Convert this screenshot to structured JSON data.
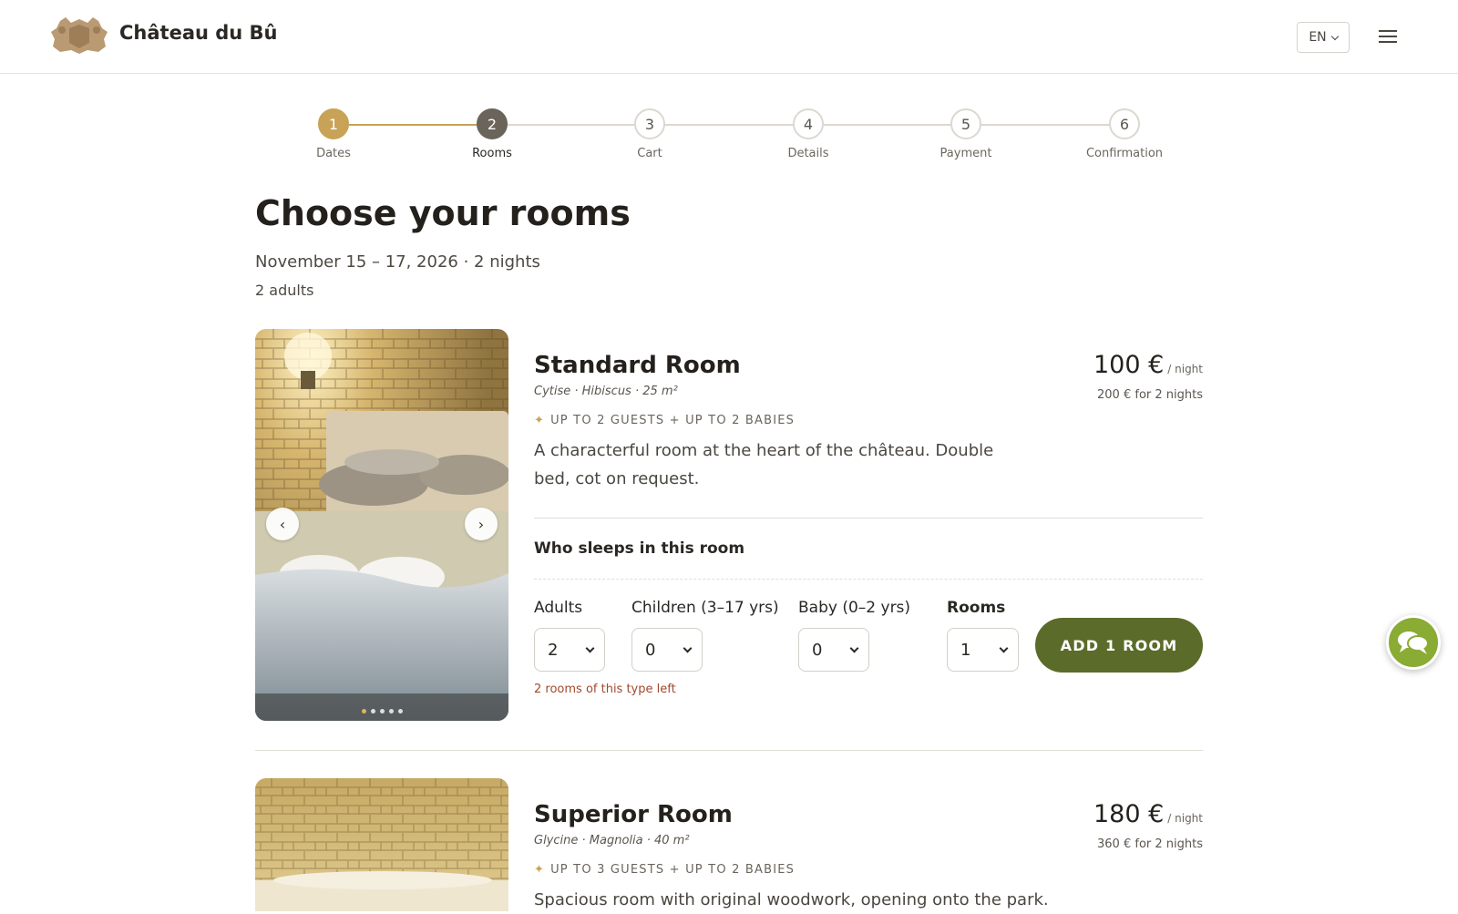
{
  "header": {
    "brand": "Château du Bû",
    "language": "EN"
  },
  "stepper": {
    "steps": [
      {
        "number": "1",
        "label": "Dates",
        "state": "done"
      },
      {
        "number": "2",
        "label": "Rooms",
        "state": "active"
      },
      {
        "number": "3",
        "label": "Cart",
        "state": "todo"
      },
      {
        "number": "4",
        "label": "Details",
        "state": "todo"
      },
      {
        "number": "5",
        "label": "Payment",
        "state": "todo"
      },
      {
        "number": "6",
        "label": "Confirmation",
        "state": "todo"
      }
    ]
  },
  "page": {
    "title": "Choose your rooms",
    "dates": "November 15 – 17, 2026 · 2 nights",
    "guests": "2 adults"
  },
  "rooms": [
    {
      "name": "Standard Room",
      "subtitle": "Cytise · Hibiscus · 25 m²",
      "capacity": "UP TO 2 GUESTS + UP TO 2 BABIES",
      "description": "A characterful room at the heart of the château. Double bed, cot on request.",
      "price": "100 €",
      "price_unit": "/ night",
      "price_total": "200 € for 2 nights",
      "who_sleeps": "Who sleeps in this room",
      "adults_label": "Adults",
      "adults_value": "2",
      "children_label": "Children (3–17 yrs)",
      "children_value": "0",
      "baby_label": "Baby (0–2 yrs)",
      "baby_value": "0",
      "rooms_label": "Rooms",
      "rooms_value": "1",
      "add_button": "ADD 1 ROOM",
      "availability": "2 rooms of this type left",
      "photo_count": 5,
      "photo_index": 1
    },
    {
      "name": "Superior Room",
      "subtitle": "Glycine · Magnolia · 40 m²",
      "capacity": "UP TO 3 GUESTS + UP TO 2 BABIES",
      "description": "Spacious room with original woodwork, opening onto the park.",
      "price": "180 €",
      "price_unit": "/ night",
      "price_total": "360 € for 2 nights"
    }
  ],
  "icons": {
    "logo": "chateau-crest-logo",
    "language_chevron": "chevron-down-icon",
    "menu": "hamburger-menu-icon",
    "chat": "chat-bubbles-icon",
    "prev": "chevron-left-icon",
    "next": "chevron-right-icon",
    "capacity": "sparkle-icon"
  },
  "colors": {
    "accent_gold": "#c8a257",
    "active_step": "#6b645a",
    "add_button": "#5b6b2a",
    "chat_button": "#8aab34",
    "availability_text": "#a04a2c"
  }
}
